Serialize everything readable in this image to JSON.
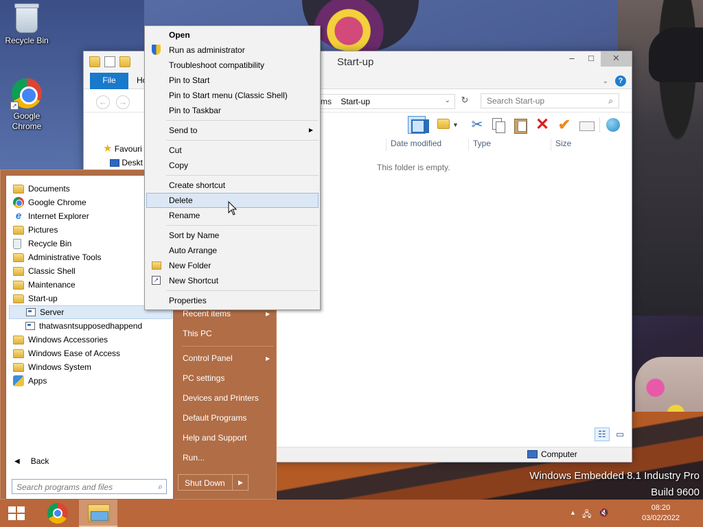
{
  "desktop": {
    "icons": [
      {
        "label": "Recycle Bin",
        "icon": "recycle-bin-icon"
      },
      {
        "label": "Google\nChrome",
        "icon": "chrome-icon"
      }
    ],
    "watermark": {
      "line1": "Windows Embedded 8.1 Industry Pro",
      "line2": "Build 9600"
    }
  },
  "explorer": {
    "title": "Start-up",
    "file_tab": "File",
    "home_tab": "Ho",
    "address": {
      "prev": "ms",
      "current": "Start-up"
    },
    "search_placeholder": "Search Start-up",
    "nav": {
      "favourites": "Favouri",
      "desktop": "Deskt"
    },
    "columns": [
      "Date modified",
      "Type",
      "Size"
    ],
    "empty_message": "This folder is empty.",
    "status": {
      "location": "Computer"
    }
  },
  "context_menu": {
    "items": [
      {
        "label": "Open",
        "bold": true
      },
      {
        "label": "Run as administrator",
        "icon": "shield-icon"
      },
      {
        "label": "Troubleshoot compatibility"
      },
      {
        "label": "Pin to Start"
      },
      {
        "label": "Pin to Start menu (Classic Shell)"
      },
      {
        "label": "Pin to Taskbar"
      },
      {
        "label": "Send to",
        "submenu": true
      },
      {
        "label": "Cut"
      },
      {
        "label": "Copy"
      },
      {
        "label": "Create shortcut"
      },
      {
        "label": "Delete",
        "hover": true
      },
      {
        "label": "Rename"
      },
      {
        "label": "Sort by Name"
      },
      {
        "label": "Auto Arrange"
      },
      {
        "label": "New Folder",
        "icon": "folder-icon"
      },
      {
        "label": "New Shortcut",
        "icon": "shortcut-icon"
      },
      {
        "label": "Properties"
      }
    ]
  },
  "start_menu": {
    "programs": [
      {
        "label": "Documents",
        "icon": "folder-icon"
      },
      {
        "label": "Google Chrome",
        "icon": "chrome-icon"
      },
      {
        "label": "Internet Explorer",
        "icon": "ie-icon"
      },
      {
        "label": "Pictures",
        "icon": "folder-icon"
      },
      {
        "label": "Recycle Bin",
        "icon": "recycle-bin-icon"
      },
      {
        "label": "Administrative Tools",
        "icon": "folder-icon"
      },
      {
        "label": "Classic Shell",
        "icon": "folder-icon"
      },
      {
        "label": "Maintenance",
        "icon": "folder-icon"
      },
      {
        "label": "Start-up",
        "icon": "folder-icon"
      },
      {
        "label": "Server",
        "icon": "app-icon",
        "sub": true,
        "selected": true
      },
      {
        "label": "thatwasntsupposedhappend",
        "icon": "app-icon",
        "sub": true
      },
      {
        "label": "Windows Accessories",
        "icon": "folder-icon"
      },
      {
        "label": "Windows Ease of Access",
        "icon": "folder-icon"
      },
      {
        "label": "Windows System",
        "icon": "folder-icon"
      },
      {
        "label": "Apps",
        "icon": "apps-icon"
      }
    ],
    "back": "Back",
    "search_placeholder": "Search programs and files",
    "right_items": [
      {
        "label": "Recent items",
        "submenu": true
      },
      {
        "label": "This PC"
      },
      {
        "label": "Control Panel",
        "submenu": true
      },
      {
        "label": "PC settings"
      },
      {
        "label": "Devices and Printers"
      },
      {
        "label": "Default Programs"
      },
      {
        "label": "Help and Support"
      },
      {
        "label": "Run..."
      }
    ],
    "shutdown": "Shut Down"
  },
  "taskbar": {
    "apps": [
      "chrome-icon",
      "file-explorer-icon"
    ],
    "clock": {
      "time": "08:20",
      "date": "03/02/2022"
    }
  },
  "colors": {
    "taskbar": "#b9673b",
    "start_menu": "#b06d46",
    "accent_blue": "#1979ca",
    "hover": "#dbe7f5"
  }
}
